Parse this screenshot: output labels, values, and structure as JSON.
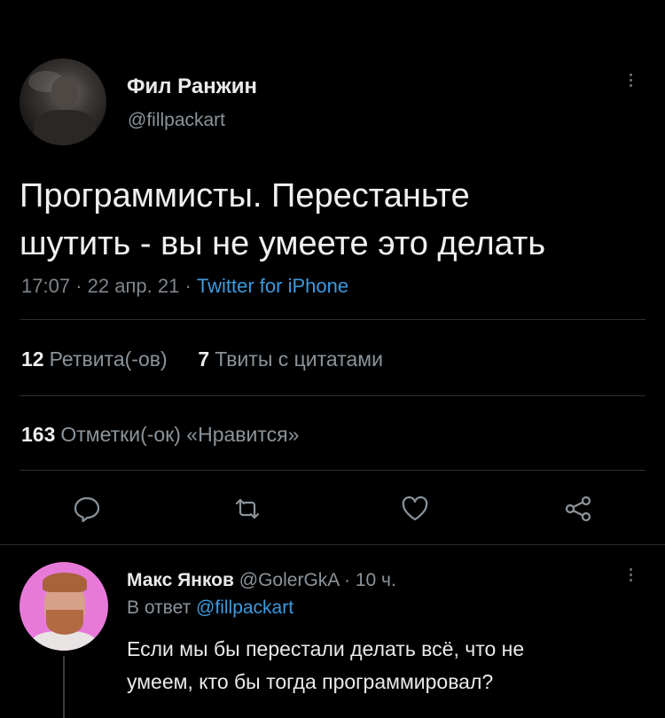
{
  "tweet": {
    "author_name": "Фил Ранжин",
    "author_handle": "@fillpackart",
    "text_line1": "Программисты. Перестаньте",
    "text_line2": "шутить - вы не умеете это делать",
    "time": "17:07",
    "date": "22 апр. 21",
    "source": "Twitter for iPhone",
    "retweets_count": "12",
    "retweets_label": "Ретвита(-ов)",
    "quotes_count": "7",
    "quotes_label": "Твиты с цитатами",
    "likes_count": "163",
    "likes_label": "Отметки(-ок) «Нравится»"
  },
  "reply": {
    "author_name": "Макс Янков",
    "author_handle": "@GolerGkA",
    "time": "10 ч.",
    "reply_prefix": "В ответ",
    "reply_mention": "@fillpackart",
    "text_line1": "Если мы бы перестали делать всё, что не",
    "text_line2": "умеем, кто бы тогда программировал?"
  },
  "icons": {
    "reply": "comment-icon",
    "retweet": "retweet-icon",
    "like": "heart-icon",
    "share": "share-icon",
    "more": "more-vertical-icon"
  },
  "colors": {
    "background": "#000000",
    "link": "#3d9ae0",
    "muted": "#8b949b"
  }
}
